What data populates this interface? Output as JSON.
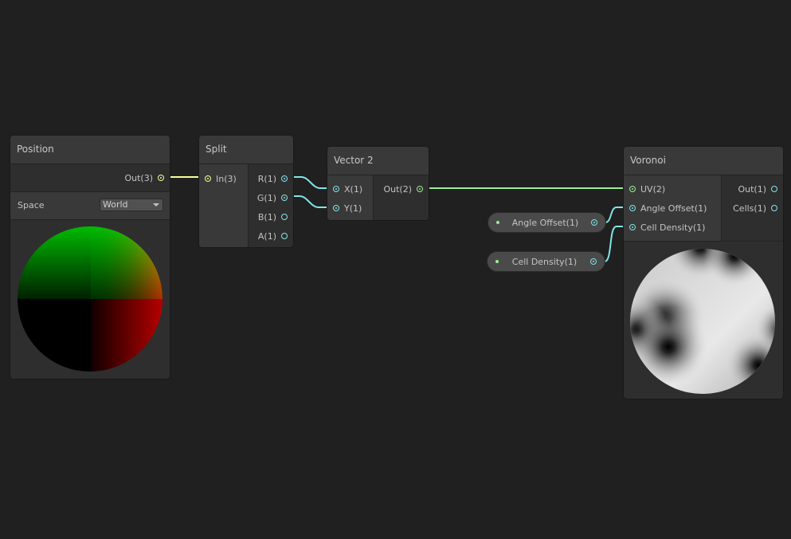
{
  "nodes": {
    "position": {
      "title": "Position",
      "outputs": [
        {
          "label": "Out(3)",
          "type": "vector3",
          "connected": true
        }
      ],
      "control": {
        "label": "Space",
        "value": "World"
      },
      "preview": "position-color-sphere"
    },
    "split": {
      "title": "Split",
      "inputs": [
        {
          "label": "In(3)",
          "type": "vector3",
          "connected": true
        }
      ],
      "outputs": [
        {
          "label": "R(1)",
          "type": "float",
          "connected": true
        },
        {
          "label": "G(1)",
          "type": "float",
          "connected": true
        },
        {
          "label": "B(1)",
          "type": "float",
          "connected": false
        },
        {
          "label": "A(1)",
          "type": "float",
          "connected": false
        }
      ]
    },
    "vector2": {
      "title": "Vector 2",
      "inputs": [
        {
          "label": "X(1)",
          "type": "float",
          "connected": true
        },
        {
          "label": "Y(1)",
          "type": "float",
          "connected": true
        }
      ],
      "outputs": [
        {
          "label": "Out(2)",
          "type": "vector2",
          "connected": true
        }
      ]
    },
    "voronoi": {
      "title": "Voronoi",
      "inputs": [
        {
          "label": "UV(2)",
          "type": "vector2",
          "connected": true
        },
        {
          "label": "Angle Offset(1)",
          "type": "float",
          "connected": true
        },
        {
          "label": "Cell Density(1)",
          "type": "float",
          "connected": true
        }
      ],
      "outputs": [
        {
          "label": "Out(1)",
          "type": "float",
          "connected": false
        },
        {
          "label": "Cells(1)",
          "type": "float",
          "connected": false
        }
      ],
      "preview": "voronoi-noise-sphere"
    }
  },
  "properties": [
    {
      "label": "Angle Offset(1)"
    },
    {
      "label": "Cell Density(1)"
    }
  ],
  "colors": {
    "background": "#202020",
    "vector3": "#f6ff9a",
    "vector2": "#9aef92",
    "float": "#84e4e7"
  }
}
